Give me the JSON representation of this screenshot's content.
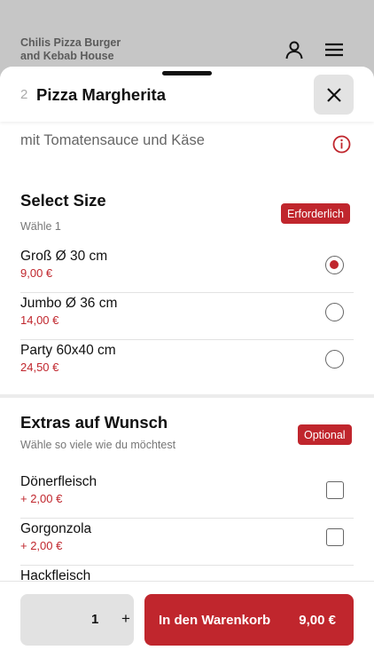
{
  "restaurant": {
    "name_line1": "Chilis Pizza Burger",
    "name_line2": "and Kebab House"
  },
  "item": {
    "quantity_prefix": "2",
    "title": "Pizza Margherita",
    "description": "mit Tomatensauce und Käse"
  },
  "sections": [
    {
      "title": "Select Size",
      "subtitle": "Wähle 1",
      "badge": "Erforderlich",
      "options": [
        {
          "name": "Groß Ø 30 cm",
          "price": "9,00 €",
          "selected": true
        },
        {
          "name": "Jumbo Ø 36 cm",
          "price": "14,00 €",
          "selected": false
        },
        {
          "name": "Party 60x40 cm",
          "price": "24,50 €",
          "selected": false
        }
      ]
    },
    {
      "title": "Extras auf Wunsch",
      "subtitle": "Wähle so viele wie du möchtest",
      "badge": "Optional",
      "options": [
        {
          "name": "Dönerfleisch",
          "price": "+ 2,00 €",
          "checked": false
        },
        {
          "name": "Gorgonzola",
          "price": "+ 2,00 €",
          "checked": false
        },
        {
          "name": "Hackfleisch",
          "price": "",
          "checked": false
        }
      ]
    }
  ],
  "footer": {
    "quantity": "1",
    "plus": "+",
    "cart_label": "In den Warenkorb",
    "cart_price": "9,00 €"
  },
  "colors": {
    "accent": "#c0262d"
  },
  "icons": [
    "user-icon",
    "menu-icon",
    "close-icon",
    "info-icon"
  ]
}
